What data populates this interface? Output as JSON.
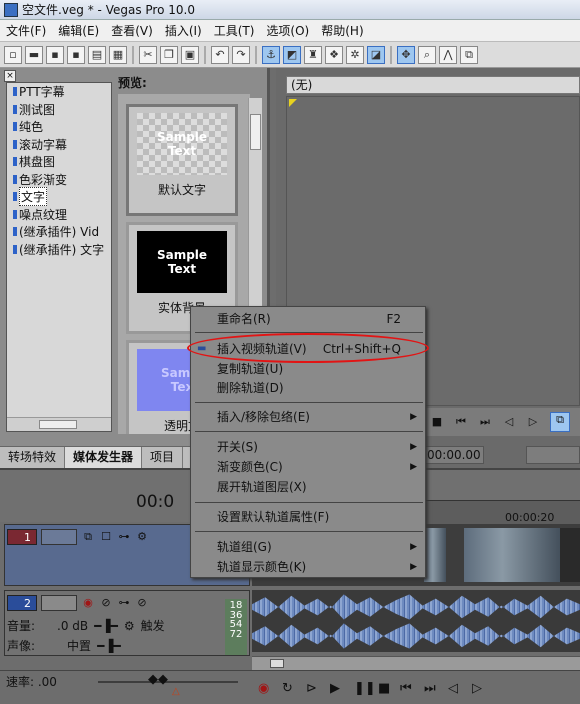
{
  "window": {
    "title": "空文件.veg * - Vegas Pro 10.0"
  },
  "menubar": {
    "items": [
      "文件(F)",
      "编辑(E)",
      "查看(V)",
      "插入(I)",
      "工具(T)",
      "选项(O)",
      "帮助(H)"
    ]
  },
  "media_generator": {
    "tree_items": [
      "PTT字幕",
      "测试图",
      "纯色",
      "滚动字幕",
      "棋盘图",
      "色彩渐变",
      "文字",
      "噪点纹理",
      "(继承插件) Vid",
      "(继承插件) 文字"
    ],
    "selected_item": "文字",
    "preview_label": "预览:",
    "presets": [
      {
        "text_line1": "Sample",
        "text_line2": "Text",
        "caption": "默认文字"
      },
      {
        "text_line1": "Sample",
        "text_line2": "Text",
        "caption": "实体背景"
      },
      {
        "text_line1": "Sampl",
        "text_line2": "Tex",
        "caption": "透明文"
      }
    ],
    "tabs": [
      "转场特效",
      "媒体发生器",
      "项目"
    ]
  },
  "preview_window": {
    "header": "(无)",
    "time": "00:00.00"
  },
  "timeline": {
    "timecode": "00:0",
    "ruler_mark": "00:00:20",
    "video_track": {
      "number": "1"
    },
    "audio_track": {
      "number": "2",
      "volume_label": "音量:",
      "volume_value": ".0 dB",
      "trigger_label": "触发",
      "pan_label": "声像:",
      "pan_value": "中置",
      "meter": [
        "18",
        "36",
        "54",
        "72"
      ]
    },
    "rate_label": "速率: .00"
  },
  "context_menu": {
    "items": [
      {
        "label": "重命名(R)",
        "shortcut": "F2"
      },
      {
        "label": "插入视频轨道(V)",
        "shortcut": "Ctrl+Shift+Q"
      },
      {
        "label": "复制轨道(U)",
        "shortcut": ""
      },
      {
        "label": "删除轨道(D)",
        "shortcut": ""
      },
      {
        "label": "插入/移除包络(E)",
        "shortcut": ""
      },
      {
        "label": "开关(S)",
        "shortcut": ""
      },
      {
        "label": "渐变颜色(C)",
        "shortcut": ""
      },
      {
        "label": "展开轨道图层(X)",
        "shortcut": ""
      },
      {
        "label": "设置默认轨道属性(F)",
        "shortcut": ""
      },
      {
        "label": "轨道组(G)",
        "shortcut": ""
      },
      {
        "label": "轨道显示颜色(K)",
        "shortcut": ""
      }
    ]
  },
  "colors": {
    "highlight_ellipse": "#e21414",
    "accent": "#3a6fc2"
  }
}
